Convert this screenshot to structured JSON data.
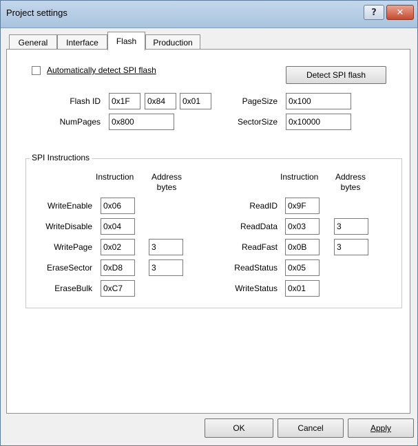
{
  "window": {
    "title": "Project settings",
    "help_glyph": "?",
    "close_glyph": "✕"
  },
  "tabs": [
    "General",
    "Interface",
    "Flash",
    "Production"
  ],
  "active_tab": "Flash",
  "flash": {
    "auto_detect_label": "Automatically detect SPI flash",
    "auto_detect_checked": false,
    "detect_button": "Detect SPI flash",
    "flash_id_label": "Flash ID",
    "flash_id": [
      "0x1F",
      "0x84",
      "0x01"
    ],
    "num_pages_label": "NumPages",
    "num_pages": "0x800",
    "page_size_label": "PageSize",
    "page_size": "0x100",
    "sector_size_label": "SectorSize",
    "sector_size": "0x10000"
  },
  "spi": {
    "group_title": "SPI Instructions",
    "col_instruction": "Instruction",
    "col_address_1": "Address",
    "col_address_2": "bytes",
    "left": [
      {
        "name": "WriteEnable",
        "instruction": "0x06",
        "address": ""
      },
      {
        "name": "WriteDisable",
        "instruction": "0x04",
        "address": ""
      },
      {
        "name": "WritePage",
        "instruction": "0x02",
        "address": "3"
      },
      {
        "name": "EraseSector",
        "instruction": "0xD8",
        "address": "3"
      },
      {
        "name": "EraseBulk",
        "instruction": "0xC7",
        "address": ""
      }
    ],
    "right": [
      {
        "name": "ReadID",
        "instruction": "0x9F",
        "address": ""
      },
      {
        "name": "ReadData",
        "instruction": "0x03",
        "address": "3"
      },
      {
        "name": "ReadFast",
        "instruction": "0x0B",
        "address": "3"
      },
      {
        "name": "ReadStatus",
        "instruction": "0x05",
        "address": ""
      },
      {
        "name": "WriteStatus",
        "instruction": "0x01",
        "address": ""
      }
    ]
  },
  "footer": {
    "ok": "OK",
    "cancel": "Cancel",
    "apply": "Apply"
  }
}
